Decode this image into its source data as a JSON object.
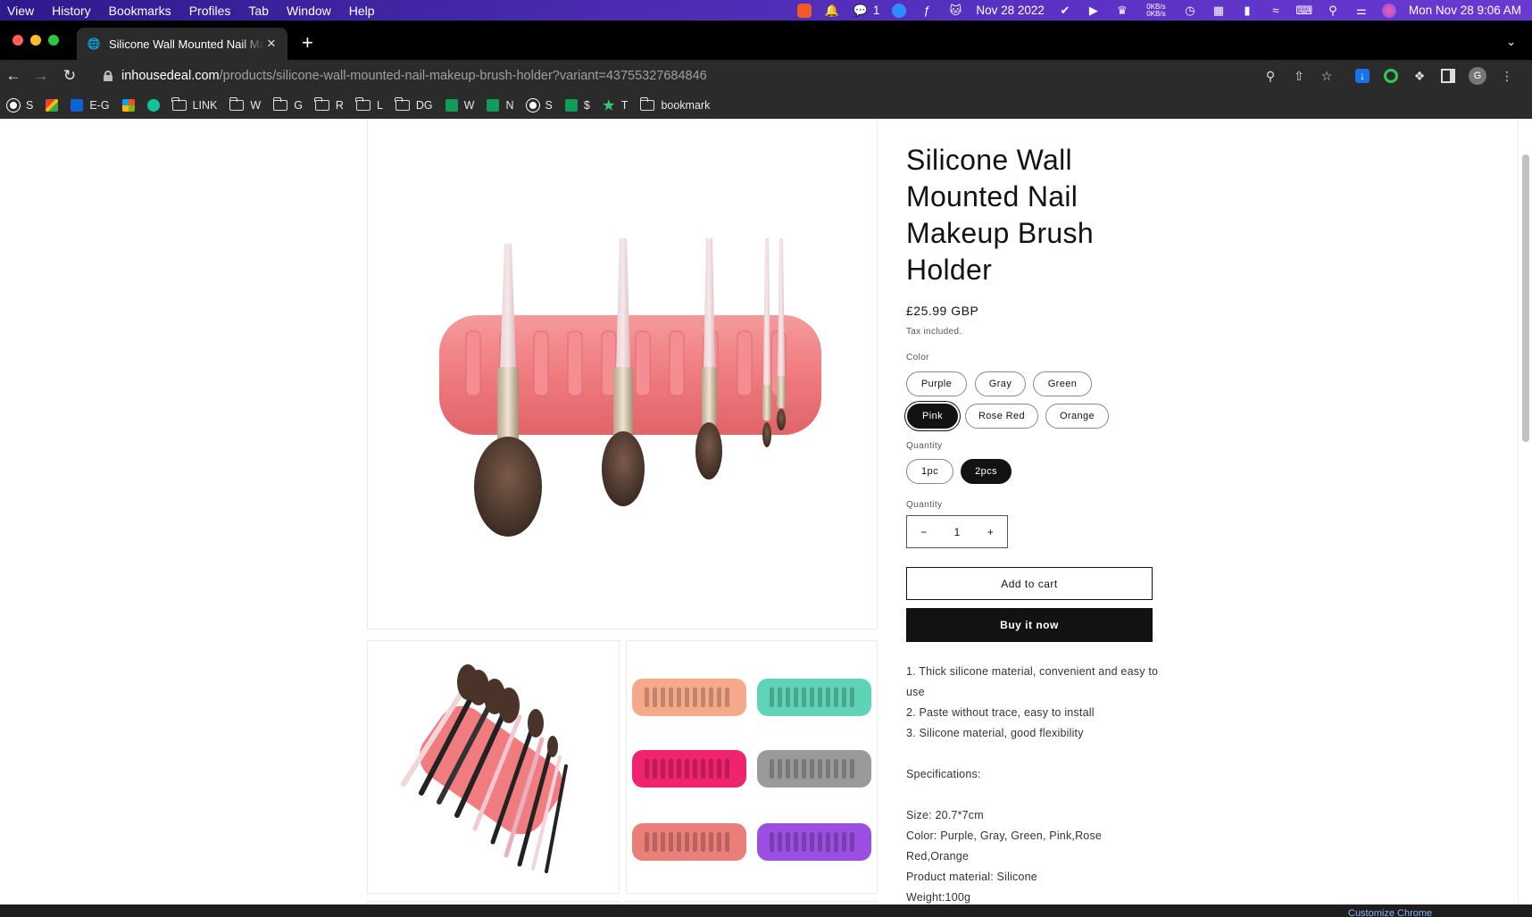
{
  "menubar": {
    "items": [
      "View",
      "History",
      "Bookmarks",
      "Profiles",
      "Tab",
      "Window",
      "Help"
    ],
    "wechat_count": "1",
    "date_widget": "Nov 28 2022",
    "net_up": "0KB/s",
    "net_down": "0KB/s",
    "clock": "Mon Nov 28  9:06 AM"
  },
  "browser": {
    "tab_title": "Silicone Wall Mounted Nail Makeup Brush Holder",
    "url_host": "inhousedeal.com",
    "url_path": "/products/silicone-wall-mounted-nail-makeup-brush-holder?variant=43755327684846",
    "bookmarks": [
      {
        "label": "S",
        "icon": "globe-icon"
      },
      {
        "label": "",
        "icon": "gmail-icon"
      },
      {
        "label": "E-G",
        "icon": "outlook-icon"
      },
      {
        "label": "",
        "icon": "microsoft-icon"
      },
      {
        "label": "",
        "icon": "grammarly-icon"
      },
      {
        "label": "LINK",
        "icon": "folder-icon"
      },
      {
        "label": "W",
        "icon": "folder-icon"
      },
      {
        "label": "G",
        "icon": "folder-icon"
      },
      {
        "label": "R",
        "icon": "folder-icon"
      },
      {
        "label": "L",
        "icon": "folder-icon"
      },
      {
        "label": "DG",
        "icon": "folder-icon"
      },
      {
        "label": "W",
        "icon": "sheets-icon"
      },
      {
        "label": "N",
        "icon": "sheets-icon"
      },
      {
        "label": "S",
        "icon": "globe-icon"
      },
      {
        "label": "$",
        "icon": "sheets-icon"
      },
      {
        "label": "T",
        "icon": "star-icon"
      },
      {
        "label": "bookmark",
        "icon": "folder-icon"
      }
    ],
    "customize_label": "Customize Chrome"
  },
  "product": {
    "title": "Silicone Wall Mounted Nail Makeup Brush Holder",
    "price": "£25.99 GBP",
    "tax_note": "Tax included.",
    "color_label": "Color",
    "colors": [
      "Purple",
      "Gray",
      "Green",
      "Pink",
      "Rose Red",
      "Orange"
    ],
    "selected_color": "Pink",
    "variant_label": "Quantity",
    "variants": [
      "1pc",
      "2pcs"
    ],
    "selected_variant": "2pcs",
    "quantity_label": "Quantity",
    "quantity_value": "1",
    "decrease_symbol": "−",
    "increase_symbol": "+",
    "add_to_cart": "Add to cart",
    "buy_now": "Buy it now",
    "description": [
      "1. Thick silicone material, convenient and easy to use",
      "2. Paste without trace, easy to install",
      "3. Silicone material, good flexibility",
      "",
      "Specifications:",
      "",
      "Size: 20.7*7cm",
      "Color: Purple, Gray, Green, Pink,Rose Red,Orange",
      "Product material: Silicone",
      "Weight:100g"
    ],
    "swatch_colors": [
      "#f6a98a",
      "#5fd3b8",
      "#f0246e",
      "#9a9a9a",
      "#ea7f7a",
      "#9b4fe0"
    ],
    "holder_color": "#f07c80"
  }
}
